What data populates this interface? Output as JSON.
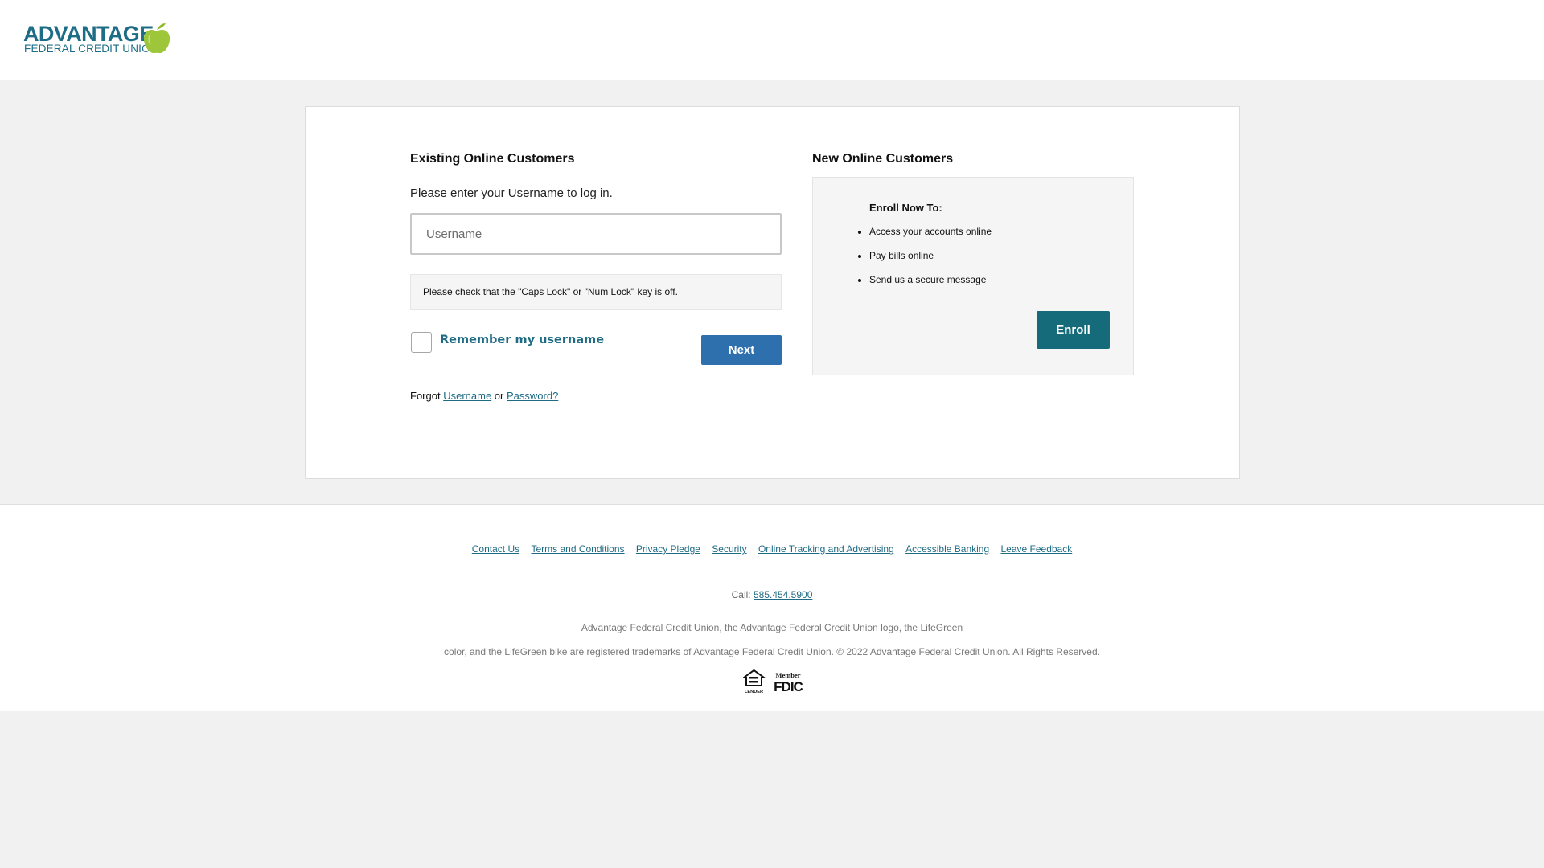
{
  "header": {
    "logo": {
      "brand": "ADVANTAGE",
      "subtitle": "FEDERAL CREDIT UNION"
    }
  },
  "login": {
    "title": "Existing Online Customers",
    "prompt": "Please enter your Username to log in.",
    "username_placeholder": "Username",
    "caps_lock_notice": "Please check that the \"Caps Lock\" or \"Num Lock\" key is off.",
    "remember_label": "Remember my username",
    "next_label": "Next",
    "forgot_prefix": "Forgot",
    "forgot_username": "Username",
    "forgot_or": "or",
    "forgot_password": "Password?"
  },
  "enroll": {
    "title": "New Online Customers",
    "panel_title": "Enroll Now To:",
    "items": [
      "Access your accounts online",
      "Pay bills online",
      "Send us a secure message"
    ],
    "button_label": "Enroll"
  },
  "footer": {
    "links": [
      "Contact Us",
      "Terms and Conditions",
      "Privacy Pledge",
      "Security",
      "Online Tracking and Advertising",
      "Accessible Banking",
      "Leave Feedback"
    ],
    "call_label": "Call:",
    "phone": "585.454.5900",
    "legal_line1": "Advantage Federal Credit Union, the Advantage Federal Credit Union logo, the LifeGreen",
    "legal_line2": "color, and the LifeGreen bike are registered trademarks of Advantage Federal Credit Union. © 2022 Advantage Federal Credit Union. All Rights Reserved.",
    "badges": {
      "equal_housing_text": "LENDER",
      "fdic_member": "Member",
      "fdic": "FDIC"
    }
  },
  "colors": {
    "brand_teal": "#1d6d86",
    "apple_green": "#8dbb2b",
    "next_button": "#2d70ad",
    "enroll_button": "#156b79",
    "link": "#1f6b84"
  }
}
